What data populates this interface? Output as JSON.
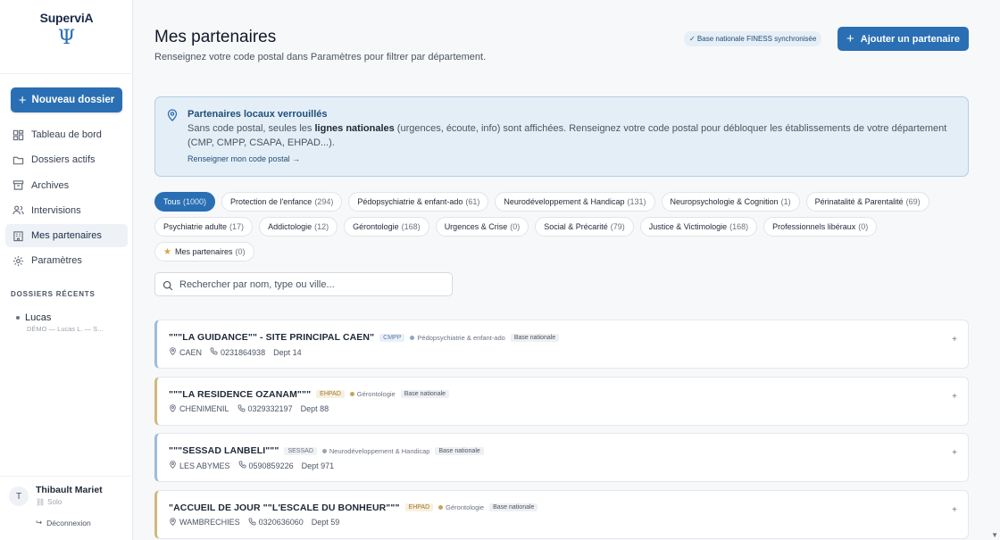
{
  "brand": {
    "name": "SuperviA",
    "logo_glyph": "Ψ"
  },
  "sidebar": {
    "new_button": "Nouveau dossier",
    "items": [
      {
        "label": "Tableau de bord",
        "icon": "dashboard-icon"
      },
      {
        "label": "Dossiers actifs",
        "icon": "folder-icon"
      },
      {
        "label": "Archives",
        "icon": "archive-icon"
      },
      {
        "label": "Intervisions",
        "icon": "users-icon"
      },
      {
        "label": "Mes partenaires",
        "icon": "building-icon",
        "active": true
      },
      {
        "label": "Paramètres",
        "icon": "gear-icon"
      }
    ],
    "recent_title": "DOSSIERS RÉCENTS",
    "recent": [
      {
        "name": "Lucas",
        "sub": "DÉMO — Lucas L. — S..."
      }
    ],
    "user": {
      "initial": "T",
      "name": "Thibault Mariet",
      "plan": "Solo",
      "logout": "Déconnexion"
    }
  },
  "header": {
    "title": "Mes partenaires",
    "subtitle": "Renseignez votre code postal dans Paramètres pour filtrer par département.",
    "sync_badge": "✓ Base nationale FINESS synchronisée",
    "add_button": "Ajouter un partenaire"
  },
  "alert": {
    "title": "Partenaires locaux verrouillés",
    "text_before": "Sans code postal, seules les ",
    "text_bold": "lignes nationales",
    "text_after": " (urgences, écoute, info) sont affichées. Renseignez votre code postal pour débloquer les établissements de votre département (CMP, CMPP, CSAPA, EHPAD...).",
    "link": "Renseigner mon code postal →"
  },
  "filters": [
    {
      "label": "Tous",
      "count": "(1000)",
      "active": true
    },
    {
      "label": "Protection de l'enfance",
      "count": "(294)"
    },
    {
      "label": "Pédopsychiatrie & enfant-ado",
      "count": "(61)"
    },
    {
      "label": "Neurodéveloppement & Handicap",
      "count": "(131)"
    },
    {
      "label": "Neuropsychologie & Cognition",
      "count": "(1)"
    },
    {
      "label": "Périnatalité & Parentalité",
      "count": "(69)"
    },
    {
      "label": "Psychiatrie adulte",
      "count": "(17)"
    },
    {
      "label": "Addictologie",
      "count": "(12)"
    },
    {
      "label": "Gérontologie",
      "count": "(168)"
    },
    {
      "label": "Urgences & Crise",
      "count": "(0)"
    },
    {
      "label": "Social & Précarité",
      "count": "(79)"
    },
    {
      "label": "Justice & Victimologie",
      "count": "(168)"
    },
    {
      "label": "Professionnels libéraux",
      "count": "(0)"
    },
    {
      "label": "Mes partenaires",
      "count": "(0)",
      "star": true
    }
  ],
  "search": {
    "placeholder": "Rechercher par nom, type ou ville..."
  },
  "partners": [
    {
      "name": "\"\"\"LA GUIDANCE\"\" - SITE PRINCIPAL CAEN\"",
      "type": "CMPP",
      "type_style": "blue",
      "category": "Pédopsychiatrie & enfant-ado",
      "cat_color": "blue",
      "base": "Base nationale",
      "city": "CAEN",
      "phone": "0231864938",
      "dept": "Dept 14",
      "accent": "blue"
    },
    {
      "name": "\"\"\"LA RESIDENCE OZANAM\"\"\"",
      "type": "EHPAD",
      "type_style": "ehpad",
      "category": "Gérontologie",
      "cat_color": "gold",
      "base": "Base nationale",
      "city": "CHENIMENIL",
      "phone": "0329332197",
      "dept": "Dept 88",
      "accent": "gold"
    },
    {
      "name": "\"\"\"SESSAD LANBELI\"\"\"",
      "type": "SESSAD",
      "type_style": "sessad",
      "category": "Neurodéveloppement & Handicap",
      "cat_color": "grey",
      "base": "Base nationale",
      "city": "LES ABYMES",
      "phone": "0590859226",
      "dept": "Dept 971",
      "accent": "blue"
    },
    {
      "name": "\"ACCUEIL DE JOUR \"\"L'ESCALE DU BONHEUR\"\"\"",
      "type": "EHPAD",
      "type_style": "ehpad",
      "category": "Gérontologie",
      "cat_color": "gold",
      "base": "Base nationale",
      "city": "WAMBRECHIES",
      "phone": "0320636060",
      "dept": "Dept 59",
      "accent": "gold"
    }
  ]
}
